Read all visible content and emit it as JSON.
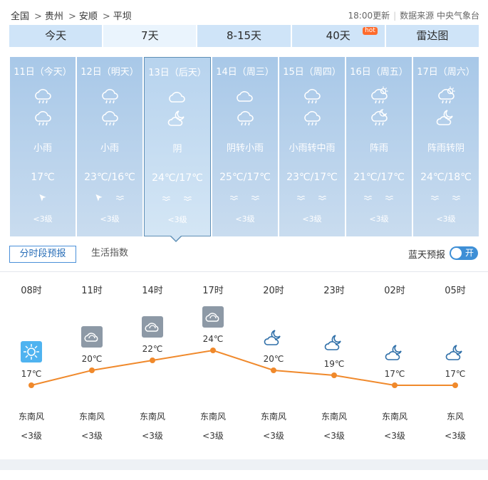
{
  "breadcrumb": [
    "全国",
    "贵州",
    "安顺",
    "平坝"
  ],
  "updated": {
    "time": "18:00更新",
    "source": "数据来源 中央气象台"
  },
  "tabs": [
    {
      "label": "今天"
    },
    {
      "label": "7天",
      "active": true
    },
    {
      "label": "8-15天"
    },
    {
      "label": "40天",
      "badge": "hot"
    },
    {
      "label": "雷达图"
    }
  ],
  "days": [
    {
      "date": "11日（今天）",
      "icon1": "cloud-rain-icon",
      "icon2": "cloud-rain-icon",
      "cond": "小雨",
      "temp": "17℃",
      "wind": [
        "arrow-icon"
      ],
      "level": "<3级"
    },
    {
      "date": "12日（明天）",
      "icon1": "cloud-rain-icon",
      "icon2": "cloud-rain-icon",
      "cond": "小雨",
      "temp": "23℃/16℃",
      "wind": [
        "arrow-icon",
        "waves-icon"
      ],
      "level": "<3级"
    },
    {
      "date": "13日（后天）",
      "icon1": "cloud-icon",
      "icon2": "moon-cloud-icon",
      "cond": "阴",
      "temp": "24℃/17℃",
      "wind": [
        "waves-icon",
        "waves-icon"
      ],
      "level": "<3级",
      "active": true
    },
    {
      "date": "14日（周三）",
      "icon1": "cloud-icon",
      "icon2": "cloud-rain-icon",
      "cond": "阴转小雨",
      "temp": "25℃/17℃",
      "wind": [
        "waves-icon",
        "waves-icon"
      ],
      "level": "<3级"
    },
    {
      "date": "15日（周四）",
      "icon1": "cloud-rain-icon",
      "icon2": "cloud-rain-icon",
      "cond": "小雨转中雨",
      "temp": "23℃/17℃",
      "wind": [
        "waves-icon",
        "waves-icon"
      ],
      "level": "<3级"
    },
    {
      "date": "16日（周五）",
      "icon1": "sun-rain-icon",
      "icon2": "moon-rain-icon",
      "cond": "阵雨",
      "temp": "21℃/17℃",
      "wind": [
        "waves-icon",
        "waves-icon"
      ],
      "level": "<3级"
    },
    {
      "date": "17日（周六）",
      "icon1": "sun-rain-icon",
      "icon2": "moon-cloud-icon",
      "cond": "阵雨转阴",
      "temp": "24℃/18℃",
      "wind": [
        "waves-icon",
        "waves-icon"
      ],
      "level": "<3级"
    }
  ],
  "subtabs": {
    "active": "分时段预报",
    "other": "生活指数"
  },
  "bluesky": {
    "label": "蓝天预报",
    "toggle": "开"
  },
  "hourly": [
    {
      "time": "08时",
      "icon": "sun-icon",
      "temp": 17,
      "temp_label": "17℃",
      "wind": "东南风",
      "level": "<3级"
    },
    {
      "time": "11时",
      "icon": "cloud-box-icon",
      "temp": 20,
      "temp_label": "20℃",
      "wind": "东南风",
      "level": "<3级"
    },
    {
      "time": "14时",
      "icon": "cloud-box-icon",
      "temp": 22,
      "temp_label": "22℃",
      "wind": "东南风",
      "level": "<3级"
    },
    {
      "time": "17时",
      "icon": "cloud-box-icon",
      "temp": 24,
      "temp_label": "24℃",
      "wind": "东南风",
      "level": "<3级"
    },
    {
      "time": "20时",
      "icon": "moon-cloud-icon",
      "temp": 20,
      "temp_label": "20℃",
      "wind": "东南风",
      "level": "<3级"
    },
    {
      "time": "23时",
      "icon": "moon-cloud-icon",
      "temp": 19,
      "temp_label": "19℃",
      "wind": "东南风",
      "level": "<3级"
    },
    {
      "time": "02时",
      "icon": "moon-cloud-icon",
      "temp": 17,
      "temp_label": "17℃",
      "wind": "东南风",
      "level": "<3级"
    },
    {
      "time": "05时",
      "icon": "moon-cloud-icon",
      "temp": 17,
      "temp_label": "17℃",
      "wind": "东风",
      "level": "<3级"
    }
  ],
  "colors": {
    "line": "#f0892b",
    "tab": "#cfe4f8",
    "accent": "#3e8fd6",
    "sun": "#4fb3f0"
  }
}
